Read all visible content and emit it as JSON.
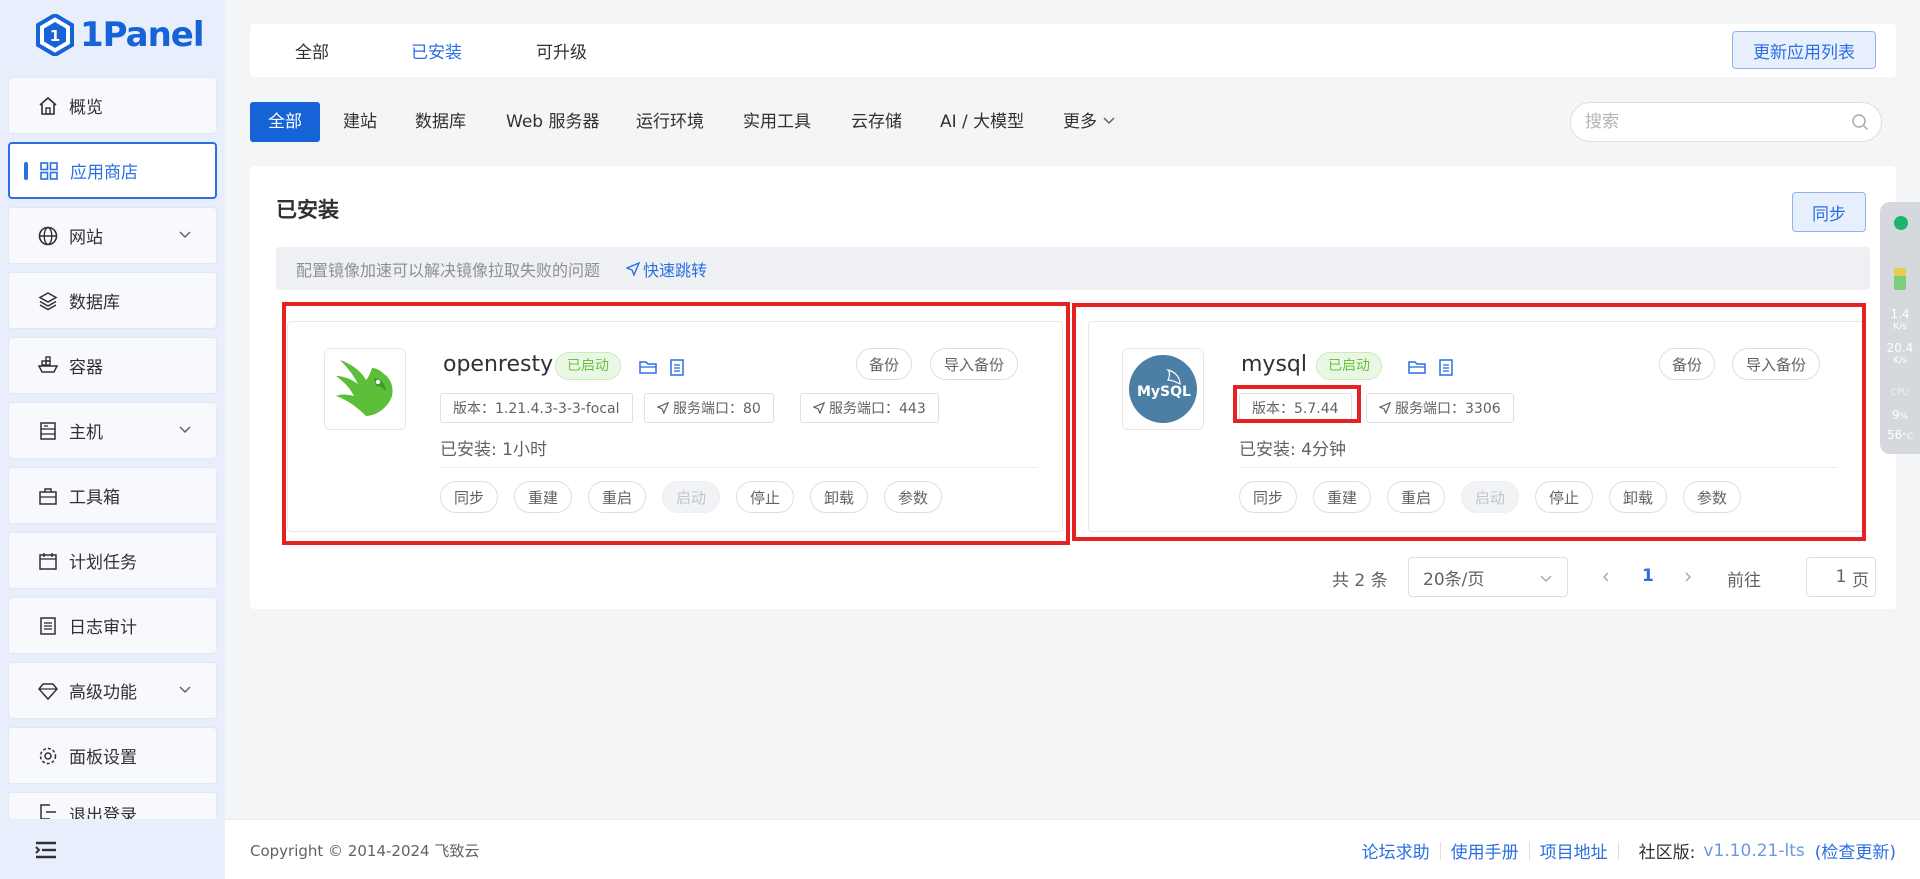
{
  "brand": {
    "name": "1Panel"
  },
  "sidebar": {
    "items": [
      {
        "label": "概览",
        "icon": "home-icon",
        "expandable": false
      },
      {
        "label": "应用商店",
        "icon": "grid-icon",
        "expandable": false,
        "active": true
      },
      {
        "label": "网站",
        "icon": "globe-icon",
        "expandable": true
      },
      {
        "label": "数据库",
        "icon": "layers-icon",
        "expandable": false
      },
      {
        "label": "容器",
        "icon": "container-ship-icon",
        "expandable": false
      },
      {
        "label": "主机",
        "icon": "server-icon",
        "expandable": true
      },
      {
        "label": "工具箱",
        "icon": "toolbox-icon",
        "expandable": false
      },
      {
        "label": "计划任务",
        "icon": "calendar-icon",
        "expandable": false
      },
      {
        "label": "日志审计",
        "icon": "log-icon",
        "expandable": false
      },
      {
        "label": "高级功能",
        "icon": "diamond-icon",
        "expandable": true
      },
      {
        "label": "面板设置",
        "icon": "gear-icon",
        "expandable": false
      },
      {
        "label": "退出登录",
        "icon": "logout-icon",
        "expandable": false
      }
    ]
  },
  "top_tabs": {
    "items": [
      "全部",
      "已安装",
      "可升级"
    ],
    "active": "已安装",
    "refresh_label": "更新应用列表"
  },
  "categories": {
    "items": [
      "全部",
      "建站",
      "数据库",
      "Web 服务器",
      "运行环境",
      "实用工具",
      "云存储",
      "AI / 大模型",
      "更多"
    ],
    "active": "全部"
  },
  "search": {
    "placeholder": "搜索"
  },
  "main": {
    "title": "已安装",
    "sync_label": "同步",
    "notice": "配置镜像加速可以解决镜像拉取失败的问题",
    "notice_link": "快速跳转"
  },
  "apps": [
    {
      "name": "openresty",
      "status": "已启动",
      "version": "版本：1.21.4.3-3-3-focal",
      "ports": [
        "服务端口：80",
        "服务端口：443"
      ],
      "installed": "已安装:   1小时",
      "top_buttons": [
        "备份",
        "导入备份"
      ],
      "actions": [
        "同步",
        "重建",
        "重启",
        "启动",
        "停止",
        "卸载",
        "参数"
      ]
    },
    {
      "name": "mysql",
      "status": "已启动",
      "version": "版本：5.7.44",
      "ports": [
        "服务端口：3306"
      ],
      "installed": "已安装:   4分钟",
      "top_buttons": [
        "备份",
        "导入备份"
      ],
      "actions": [
        "同步",
        "重建",
        "重启",
        "启动",
        "停止",
        "卸载",
        "参数"
      ],
      "logo_text": "MySQL"
    }
  ],
  "pagination": {
    "total": "共 2 条",
    "page_size": "20条/页",
    "current": "1",
    "goto_label": "前往",
    "goto_value": "1",
    "page_suffix": "页"
  },
  "footer": {
    "copyright": "Copyright © 2014-2024 飞致云",
    "links": [
      "论坛求助",
      "使用手册",
      "项目地址"
    ],
    "edition": "社区版:",
    "version": "v1.10.21-lts",
    "check_update": "(检查更新)"
  },
  "monitor": {
    "net_up": "1.4",
    "net_down": "20.4",
    "unit": "K/s",
    "cpu_label": "CPU",
    "cpu_value": "9",
    "cpu_unit": "%",
    "temp_value": "56",
    "temp_unit": "°C"
  }
}
